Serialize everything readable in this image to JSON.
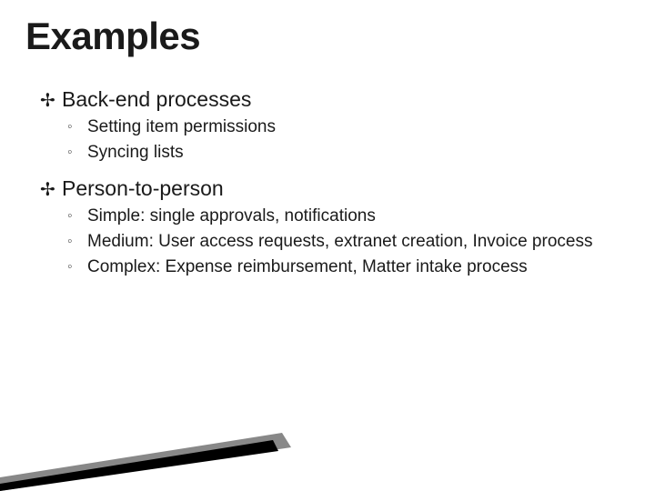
{
  "title": "Examples",
  "bullets": {
    "0": {
      "marker": "✢",
      "text": "Back-end processes",
      "subs": {
        "0": {
          "marker": "◦",
          "text": "Setting item permissions"
        },
        "1": {
          "marker": "◦",
          "text": "Syncing lists"
        }
      }
    },
    "1": {
      "marker": "✢",
      "text": "Person-to-person",
      "subs": {
        "0": {
          "marker": "◦",
          "text": "Simple: single approvals, notifications"
        },
        "1": {
          "marker": "◦",
          "text": "Medium: User access requests, extranet creation, Invoice process"
        },
        "2": {
          "marker": "◦",
          "text": "Complex: Expense reimbursement, Matter intake process"
        }
      }
    }
  }
}
